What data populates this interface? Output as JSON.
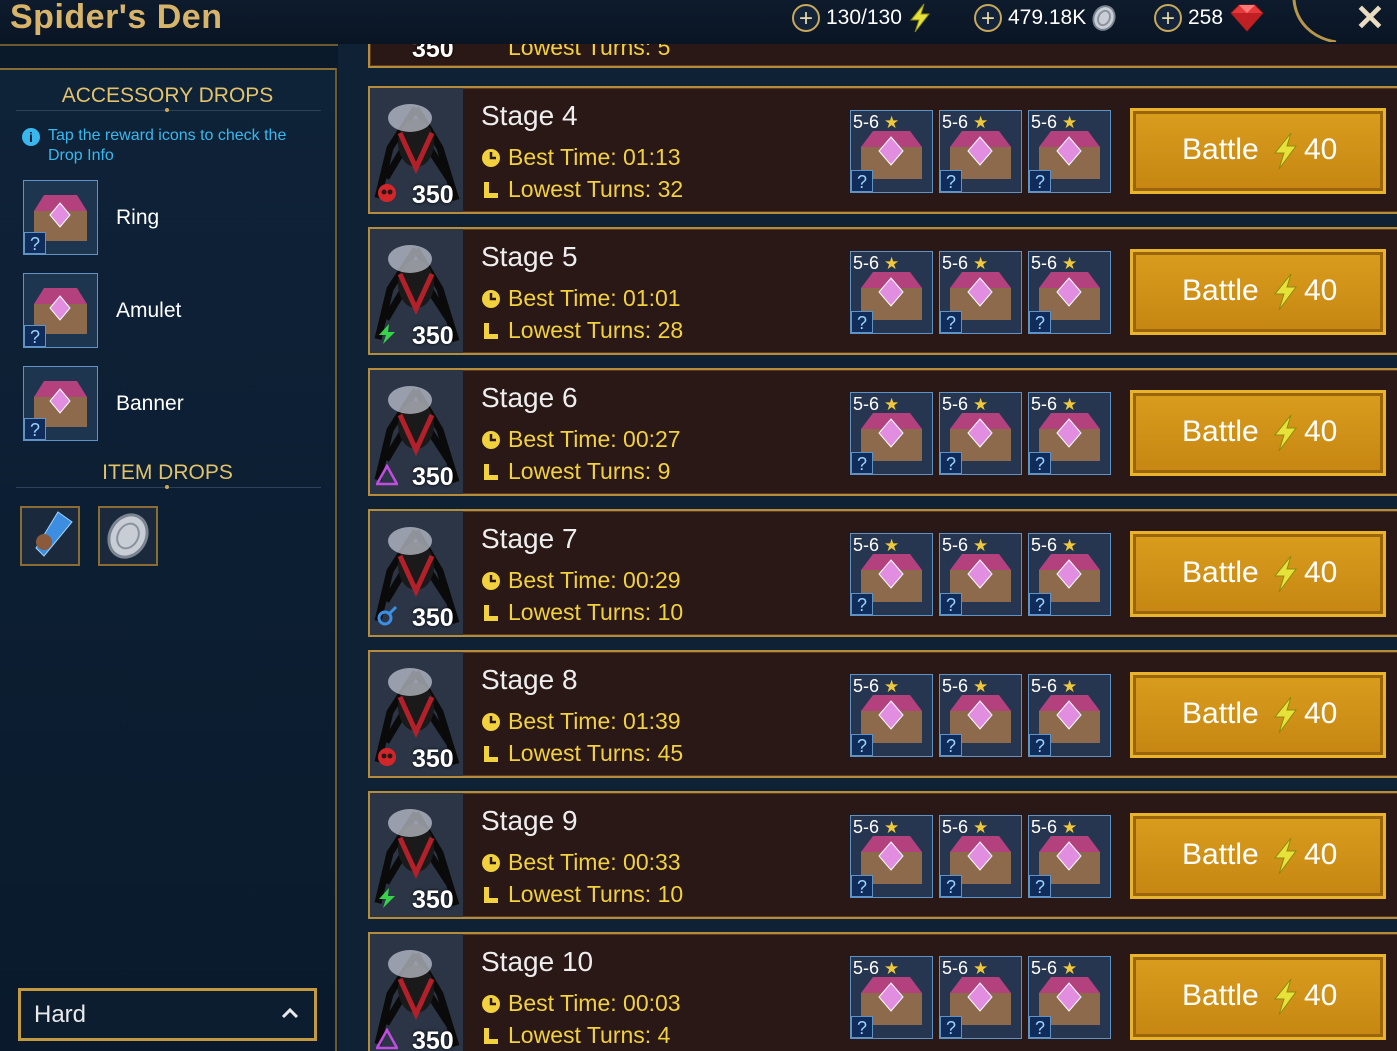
{
  "header": {
    "title": "Spider's Den",
    "energy": "130/130",
    "silver": "479.18K",
    "gems": "258",
    "close_label": "✕"
  },
  "sidebar": {
    "accessory_heading": "ACCESSORY DROPS",
    "hint": "Tap the reward icons to check the Drop Info",
    "accessories": [
      {
        "label": "Ring"
      },
      {
        "label": "Amulet"
      },
      {
        "label": "Banner"
      }
    ],
    "item_heading": "ITEM DROPS",
    "difficulty": "Hard"
  },
  "partial_top_row": {
    "level": "350",
    "lowest_turns": "Lowest Turns: 5"
  },
  "stages": [
    {
      "name": "Stage 4",
      "best_time": "Best Time: 01:13",
      "lowest_turns": "Lowest Turns: 32",
      "level": "350",
      "affinity": "force"
    },
    {
      "name": "Stage 5",
      "best_time": "Best Time: 01:01",
      "lowest_turns": "Lowest Turns: 28",
      "level": "350",
      "affinity": "spirit"
    },
    {
      "name": "Stage 6",
      "best_time": "Best Time: 00:27",
      "lowest_turns": "Lowest Turns: 9",
      "level": "350",
      "affinity": "void"
    },
    {
      "name": "Stage 7",
      "best_time": "Best Time: 00:29",
      "lowest_turns": "Lowest Turns: 10",
      "level": "350",
      "affinity": "magic"
    },
    {
      "name": "Stage 8",
      "best_time": "Best Time: 01:39",
      "lowest_turns": "Lowest Turns: 45",
      "level": "350",
      "affinity": "force"
    },
    {
      "name": "Stage 9",
      "best_time": "Best Time: 00:33",
      "lowest_turns": "Lowest Turns: 10",
      "level": "350",
      "affinity": "spirit"
    },
    {
      "name": "Stage 10",
      "best_time": "Best Time: 00:03",
      "lowest_turns": "Lowest Turns: 4",
      "level": "350",
      "affinity": "void"
    }
  ],
  "reward_rank": "5-6",
  "reward_question": "?",
  "battle": {
    "label": "Battle",
    "cost": "40"
  },
  "colors": {
    "gold": "#e2c26a",
    "yellow_text": "#f2d13e",
    "hint_blue": "#39b8ef",
    "battle_orange": "#d99d1d"
  }
}
